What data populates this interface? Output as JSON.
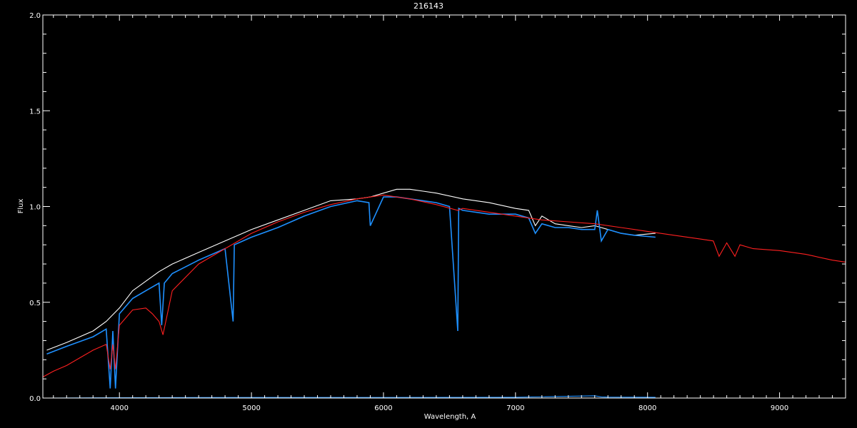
{
  "chart_data": {
    "type": "line",
    "title": "216143",
    "xlabel": "Wavelength, A",
    "ylabel": "Flux",
    "xlim": [
      3420,
      9500
    ],
    "ylim": [
      0.0,
      2.0
    ],
    "x_ticks": [
      4000,
      5000,
      6000,
      7000,
      8000,
      9000
    ],
    "x_tick_labels": [
      "4000",
      "5000",
      "6000",
      "7000",
      "8000",
      "9000"
    ],
    "y_ticks": [
      0.0,
      0.5,
      1.0,
      1.5,
      2.0
    ],
    "y_tick_labels": [
      "0.0",
      "0.5",
      "1.0",
      "1.5",
      "2.0"
    ],
    "background": "#000000",
    "axis_color": "#ffffff",
    "grid": false,
    "series": [
      {
        "color": "#ffffff",
        "x": [
          3450,
          3600,
          3800,
          3900,
          4000,
          4100,
          4200,
          4300,
          4400,
          4600,
          4800,
          5000,
          5200,
          5400,
          5600,
          5800,
          5900,
          6000,
          6100,
          6200,
          6300,
          6400,
          6600,
          6800,
          7000,
          7100,
          7150,
          7200,
          7300,
          7400,
          7500,
          7600,
          7700,
          7800,
          7900,
          8060
        ],
        "y": [
          0.25,
          0.29,
          0.35,
          0.4,
          0.47,
          0.56,
          0.61,
          0.66,
          0.7,
          0.76,
          0.82,
          0.88,
          0.93,
          0.98,
          1.03,
          1.04,
          1.05,
          1.07,
          1.09,
          1.09,
          1.08,
          1.07,
          1.04,
          1.02,
          0.99,
          0.98,
          0.9,
          0.95,
          0.91,
          0.9,
          0.89,
          0.9,
          0.88,
          0.86,
          0.85,
          0.86
        ]
      },
      {
        "color": "#1e90ff",
        "x": [
          3450,
          3600,
          3800,
          3900,
          3930,
          3950,
          3970,
          4000,
          4100,
          4200,
          4300,
          4320,
          4340,
          4400,
          4600,
          4800,
          4861,
          4870,
          5000,
          5200,
          5400,
          5600,
          5800,
          5890,
          5900,
          6000,
          6100,
          6200,
          6300,
          6400,
          6500,
          6563,
          6570,
          6600,
          6800,
          7000,
          7100,
          7150,
          7200,
          7300,
          7400,
          7500,
          7600,
          7620,
          7650,
          7700,
          7800,
          7900,
          8060
        ],
        "y": [
          0.23,
          0.27,
          0.32,
          0.36,
          0.05,
          0.35,
          0.05,
          0.44,
          0.52,
          0.56,
          0.6,
          0.38,
          0.6,
          0.65,
          0.72,
          0.78,
          0.4,
          0.8,
          0.84,
          0.89,
          0.95,
          1.0,
          1.03,
          1.02,
          0.9,
          1.05,
          1.05,
          1.04,
          1.03,
          1.02,
          1.0,
          0.35,
          0.99,
          0.98,
          0.96,
          0.96,
          0.94,
          0.86,
          0.91,
          0.89,
          0.89,
          0.88,
          0.88,
          0.98,
          0.82,
          0.88,
          0.86,
          0.85,
          0.84
        ]
      },
      {
        "color": "#ff2020",
        "x": [
          3420,
          3500,
          3600,
          3700,
          3800,
          3900,
          3930,
          3950,
          3970,
          4000,
          4100,
          4200,
          4250,
          4300,
          4330,
          4400,
          4600,
          4800,
          5000,
          5200,
          5400,
          5600,
          5800,
          6000,
          6200,
          6400,
          6563,
          6600,
          6800,
          7000,
          7200,
          7400,
          7600,
          7800,
          8000,
          8200,
          8400,
          8498,
          8542,
          8600,
          8662,
          8700,
          8800,
          9000,
          9200,
          9400,
          9500
        ],
        "y": [
          0.11,
          0.14,
          0.17,
          0.21,
          0.25,
          0.28,
          0.15,
          0.28,
          0.15,
          0.38,
          0.46,
          0.47,
          0.44,
          0.4,
          0.33,
          0.56,
          0.7,
          0.78,
          0.86,
          0.92,
          0.97,
          1.01,
          1.04,
          1.06,
          1.04,
          1.01,
          0.98,
          0.99,
          0.97,
          0.95,
          0.93,
          0.92,
          0.91,
          0.89,
          0.87,
          0.85,
          0.83,
          0.82,
          0.74,
          0.81,
          0.74,
          0.8,
          0.78,
          0.77,
          0.75,
          0.72,
          0.71
        ]
      },
      {
        "color": "#1e90ff",
        "x": [
          3450,
          4000,
          5000,
          6000,
          7000,
          7600,
          7650,
          7700,
          8060
        ],
        "y": [
          0.0,
          0.002,
          0.003,
          0.003,
          0.004,
          0.012,
          0.006,
          0.005,
          0.004
        ]
      }
    ]
  }
}
